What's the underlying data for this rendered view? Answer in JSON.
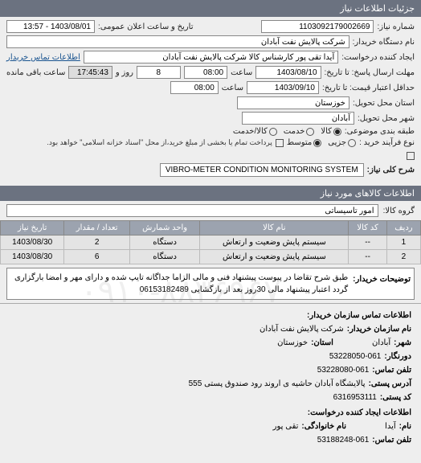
{
  "header": "جزئیات اطلاعات نیاز",
  "fields": {
    "req_no_label": "شماره نیاز:",
    "req_no": "1103092179002669",
    "announce_label": "تاریخ و ساعت اعلان عمومی:",
    "announce": "1403/08/01 - 13:57",
    "buyer_device_label": "نام دستگاه خریدار:",
    "buyer_device": "شرکت پالایش نفت آبادان",
    "requester_label": "ایجاد کننده درخواست:",
    "requester": "آیدا تقی پور کارشناس کالا شرکت پالایش نفت آبادان",
    "buyer_contact_link": "اطلاعات تماس خریدار",
    "deadline_label": "مهلت ارسال پاسخ: تا تاریخ:",
    "deadline_date": "1403/08/10",
    "time_label": "ساعت",
    "deadline_time": "08:00",
    "days_count": "8",
    "days_and": "روز و",
    "remaining_time": "17:45:43",
    "remaining_label": "ساعت باقی مانده",
    "validity_label": "حداقل اعتبار قیمت: تا تاریخ:",
    "validity_date": "1403/09/10",
    "validity_time": "08:00",
    "province_label": "استان محل تحویل:",
    "province": "خوزستان",
    "city_label": "شهر محل تحویل:",
    "city": "آبادان",
    "topic_label": "طبقه بندی موضوعی:",
    "goods_label": "کالا",
    "service_label": "خدمت",
    "goods_service_label": "کالا/خدمت",
    "buy_type_label": "نوع فرآیند خرید :",
    "partial_label": "جزیی",
    "medium_label": "متوسط",
    "buy_note": "پرداخت تمام یا بخشی از مبلغ خرید،از محل \"اسناد خزانه اسلامی\" خواهد بود.",
    "title_label": "شرح کلی نیاز:",
    "title": "VIBRO-METER CONDITION MONITORING SYSTEM"
  },
  "items_header": "اطلاعات کالاهای مورد نیاز",
  "group_label": "گروه کالا:",
  "group_value": "امور تاسیساتی",
  "table": {
    "cols": [
      "ردیف",
      "کد کالا",
      "نام کالا",
      "واحد شمارش",
      "تعداد / مقدار",
      "تاریخ نیاز"
    ],
    "rows": [
      [
        "1",
        "--",
        "سیستم پایش وضعیت و ارتعاش",
        "دستگاه",
        "2",
        "1403/08/30"
      ],
      [
        "2",
        "--",
        "سیستم پایش وضعیت و ارتعاش",
        "دستگاه",
        "6",
        "1403/08/30"
      ]
    ]
  },
  "desc_label": "توضیحات خریدار:",
  "desc_text": "طبق شرح تقاضا در پیوست پیشنهاد فنی و مالی الزاما جداگانه تایپ شده و دارای مهر و امضا بارگزاری گردد اعتبار پیشنهاد مالی 30روز بعد از بازگشایی 06153182489",
  "contact": {
    "header": "اطلاعات تماس سازمان خریدار:",
    "org_label": "نام سازمان خریدار:",
    "org": "شرکت پالایش نفت آبادان",
    "city_label": "شهر:",
    "city": "آبادان",
    "province_label": "استان:",
    "province": "خوزستان",
    "fax_label": "دورنگار:",
    "fax": "53228050-061",
    "phone_label": "تلفن تماس:",
    "phone": "53228080-061",
    "address_label": "آدرس پستی:",
    "address": "پالایشگاه آبادان حاشیه ی اروند رود صندوق پستی 555",
    "postal_label": "کد پستی:",
    "postal": "6316953111",
    "requester_header": "اطلاعات ایجاد کننده درخواست:",
    "name_label": "نام:",
    "name": "آیدا",
    "lastname_label": "نام خانوادگی:",
    "lastname": "تقی پور",
    "req_phone_label": "تلفن تماس:",
    "req_phone": "53188248-061"
  },
  "watermark": "۰۹۱۰-۸۸۳۶۹۶۷"
}
